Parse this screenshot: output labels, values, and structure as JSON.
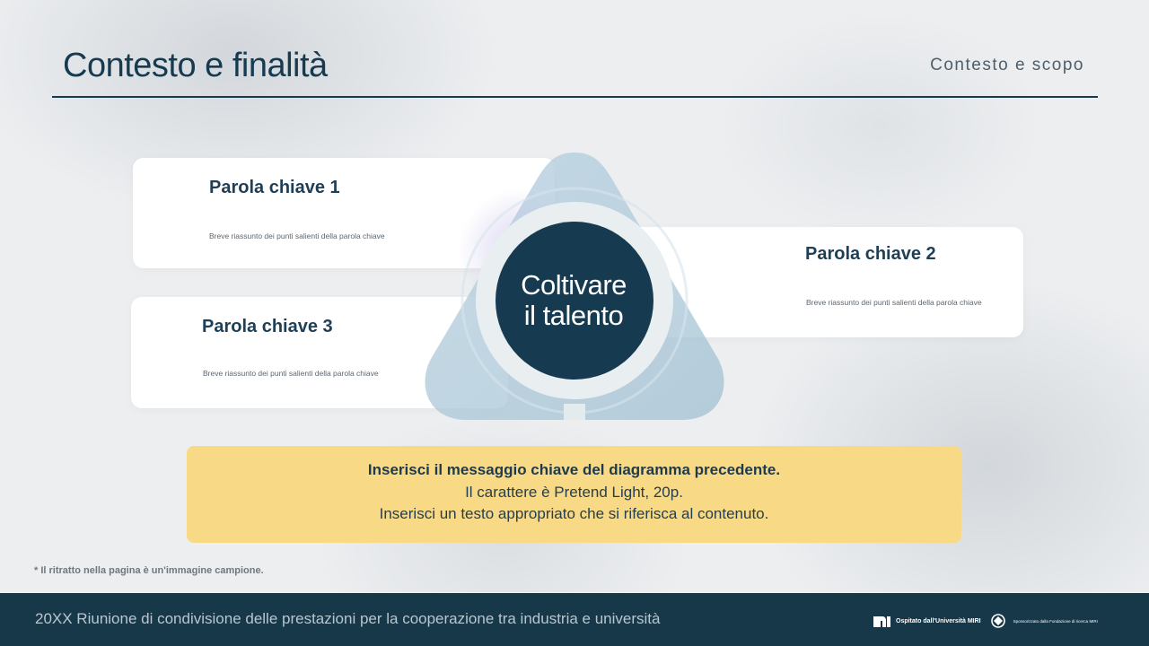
{
  "header": {
    "title": "Contesto e finalità",
    "subtitle": "Contesto e scopo"
  },
  "diagram": {
    "center_label": "Coltivare\nil talento",
    "cards": [
      {
        "keyword": "Parola chiave 1",
        "description": "Breve riassunto dei punti salienti della parola chiave"
      },
      {
        "keyword": "Parola chiave 2",
        "description": "Breve riassunto dei punti salienti della parola chiave"
      },
      {
        "keyword": "Parola chiave 3",
        "description": "Breve riassunto dei punti salienti della parola chiave"
      }
    ]
  },
  "message": {
    "line1": "Inserisci il messaggio chiave del diagramma precedente.",
    "line2": "Il carattere è Pretend Light, 20p.",
    "line3": "Inserisci un testo appropriato che si riferisca al contenuto."
  },
  "footnote": "* Il ritratto nella pagina è un'immagine campione.",
  "footer": {
    "text": "20XX Riunione di condivisione delle prestazioni per la cooperazione tra industria e università",
    "logo1_text": "Ospitato dall'Università MIRI",
    "logo2_text": "Sponsorizzato dalla Fondazione di ricerca MIRI"
  },
  "colors": {
    "primary": "#163a50",
    "accent_yellow": "#f8d985",
    "footer_bg": "#163849",
    "triangle": "#a9c6d6"
  },
  "icons": [
    "miri-logo-icon",
    "foundation-logo-icon"
  ]
}
